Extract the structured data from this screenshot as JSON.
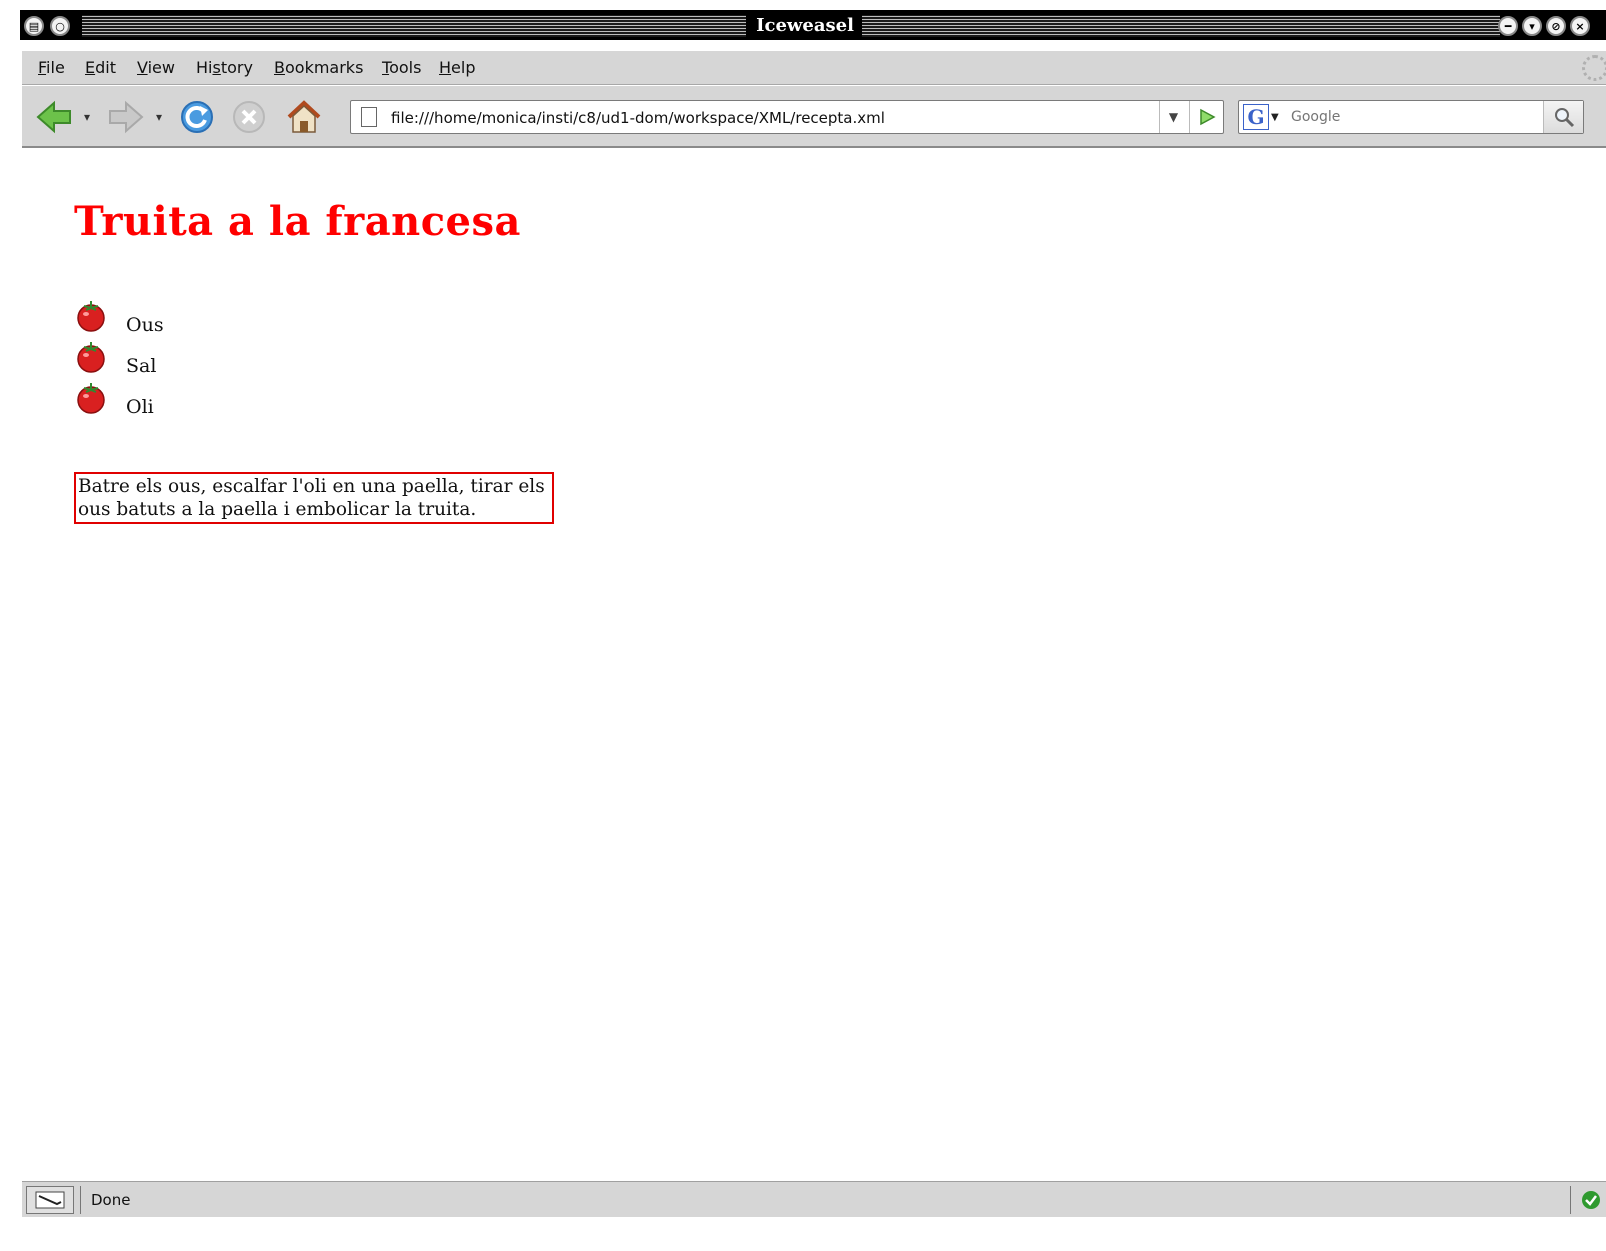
{
  "window": {
    "title": "Iceweasel"
  },
  "menubar": {
    "items": [
      {
        "label": "File",
        "accel": "F",
        "rest": "ile"
      },
      {
        "label": "Edit",
        "accel": "E",
        "rest": "dit"
      },
      {
        "label": "View",
        "accel": "V",
        "rest": "iew"
      },
      {
        "label": "History",
        "pre": "Hi",
        "accel": "s",
        "rest": "tory"
      },
      {
        "label": "Bookmarks",
        "accel": "B",
        "rest": "ookmarks"
      },
      {
        "label": "Tools",
        "accel": "T",
        "rest": "ools"
      },
      {
        "label": "Help",
        "accel": "H",
        "rest": "elp"
      }
    ]
  },
  "navbar": {
    "url": "file:///home/monica/insti/c8/ud1-dom/workspace/XML/recepta.xml",
    "search_placeholder": "Google",
    "search_engine_letter": "G"
  },
  "page": {
    "title": "Truita a la francesa",
    "ingredients": [
      "Ous",
      "Sal",
      "Oli"
    ],
    "instructions": "Batre els ous, escalfar l'oli en una paella, tirar els ous batuts a la paella i embolicar la truita."
  },
  "statusbar": {
    "text": "Done"
  },
  "colors": {
    "title_red": "#ff0000",
    "border_red": "#e00000",
    "chrome_gray": "#d6d6d6"
  },
  "icons": [
    "back-icon",
    "forward-icon",
    "reload-icon",
    "stop-icon",
    "home-icon",
    "page-icon",
    "go-icon",
    "search-icon",
    "tomato-bullet-icon",
    "secure-check-icon"
  ]
}
